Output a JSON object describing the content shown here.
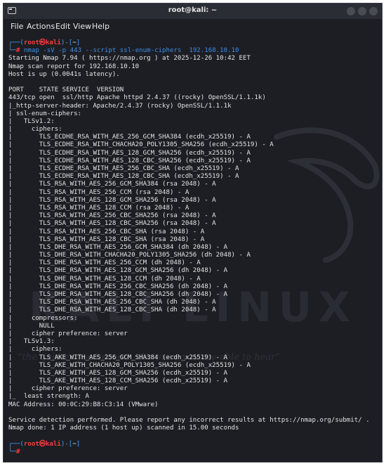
{
  "window": {
    "title": "root@kali: ~"
  },
  "menu": {
    "items": [
      "File",
      "Actions",
      "Edit",
      "View",
      "Help"
    ]
  },
  "watermark": {
    "brand": "KALI LINUX",
    "quote": "“the quieter you become, the more you are able to hear”"
  },
  "prompt": {
    "user": "root",
    "host": "kali",
    "at": "㉿",
    "path": "~",
    "symbol": "#",
    "command": "nmap -sV -p 443 --script ssl-enum-ciphers  192.168.10.10"
  },
  "output": [
    "Starting Nmap 7.94 ( https://nmap.org ) at 2025-12-26 10:42 EET",
    "Nmap scan report for 192.168.10.10",
    "Host is up (0.0041s latency).",
    "",
    "PORT    STATE SERVICE  VERSION",
    "443/tcp open  ssl/http Apache httpd 2.4.37 ((rocky) OpenSSL/1.1.1k)",
    "|_http-server-header: Apache/2.4.37 (rocky) OpenSSL/1.1.1k",
    "| ssl-enum-ciphers:",
    "|   TLSv1.2:",
    "|     ciphers:",
    "|       TLS_ECDHE_RSA_WITH_AES_256_GCM_SHA384 (ecdh_x25519) - A",
    "|       TLS_ECDHE_RSA_WITH_CHACHA20_POLY1305_SHA256 (ecdh_x25519) - A",
    "|       TLS_ECDHE_RSA_WITH_AES_128_GCM_SHA256 (ecdh_x25519) - A",
    "|       TLS_ECDHE_RSA_WITH_AES_128_CBC_SHA256 (ecdh_x25519) - A",
    "|       TLS_ECDHE_RSA_WITH_AES_256_CBC_SHA (ecdh_x25519) - A",
    "|       TLS_ECDHE_RSA_WITH_AES_128_CBC_SHA (ecdh_x25519) - A",
    "|       TLS_RSA_WITH_AES_256_GCM_SHA384 (rsa 2048) - A",
    "|       TLS_RSA_WITH_AES_256_CCM (rsa 2048) - A",
    "|       TLS_RSA_WITH_AES_128_GCM_SHA256 (rsa 2048) - A",
    "|       TLS_RSA_WITH_AES_128_CCM (rsa 2048) - A",
    "|       TLS_RSA_WITH_AES_256_CBC_SHA256 (rsa 2048) - A",
    "|       TLS_RSA_WITH_AES_128_CBC_SHA256 (rsa 2048) - A",
    "|       TLS_RSA_WITH_AES_256_CBC_SHA (rsa 2048) - A",
    "|       TLS_RSA_WITH_AES_128_CBC_SHA (rsa 2048) - A",
    "|       TLS_DHE_RSA_WITH_AES_256_GCM_SHA384 (dh 2048) - A",
    "|       TLS_DHE_RSA_WITH_CHACHA20_POLY1305_SHA256 (dh 2048) - A",
    "|       TLS_DHE_RSA_WITH_AES_256_CCM (dh 2048) - A",
    "|       TLS_DHE_RSA_WITH_AES_128_GCM_SHA256 (dh 2048) - A",
    "|       TLS_DHE_RSA_WITH_AES_128_CCM (dh 2048) - A",
    "|       TLS_DHE_RSA_WITH_AES_256_CBC_SHA256 (dh 2048) - A",
    "|       TLS_DHE_RSA_WITH_AES_128_CBC_SHA256 (dh 2048) - A",
    "|       TLS_DHE_RSA_WITH_AES_256_CBC_SHA (dh 2048) - A",
    "|       TLS_DHE_RSA_WITH_AES_128_CBC_SHA (dh 2048) - A",
    "|     compressors:",
    "|       NULL",
    "|     cipher preference: server",
    "|   TLSv1.3:",
    "|     ciphers:",
    "|       TLS_AKE_WITH_AES_256_GCM_SHA384 (ecdh_x25519) - A",
    "|       TLS_AKE_WITH_CHACHA20_POLY1305_SHA256 (ecdh_x25519) - A",
    "|       TLS_AKE_WITH_AES_128_GCM_SHA256 (ecdh_x25519) - A",
    "|       TLS_AKE_WITH_AES_128_CCM_SHA256 (ecdh_x25519) - A",
    "|     cipher preference: server",
    "|_  least strength: A",
    "MAC Address: 00:0C:29:B8:C3:14 (VMware)",
    "",
    "Service detection performed. Please report any incorrect results at https://nmap.org/submit/ .",
    "Nmap done: 1 IP address (1 host up) scanned in 15.00 seconds",
    ""
  ]
}
